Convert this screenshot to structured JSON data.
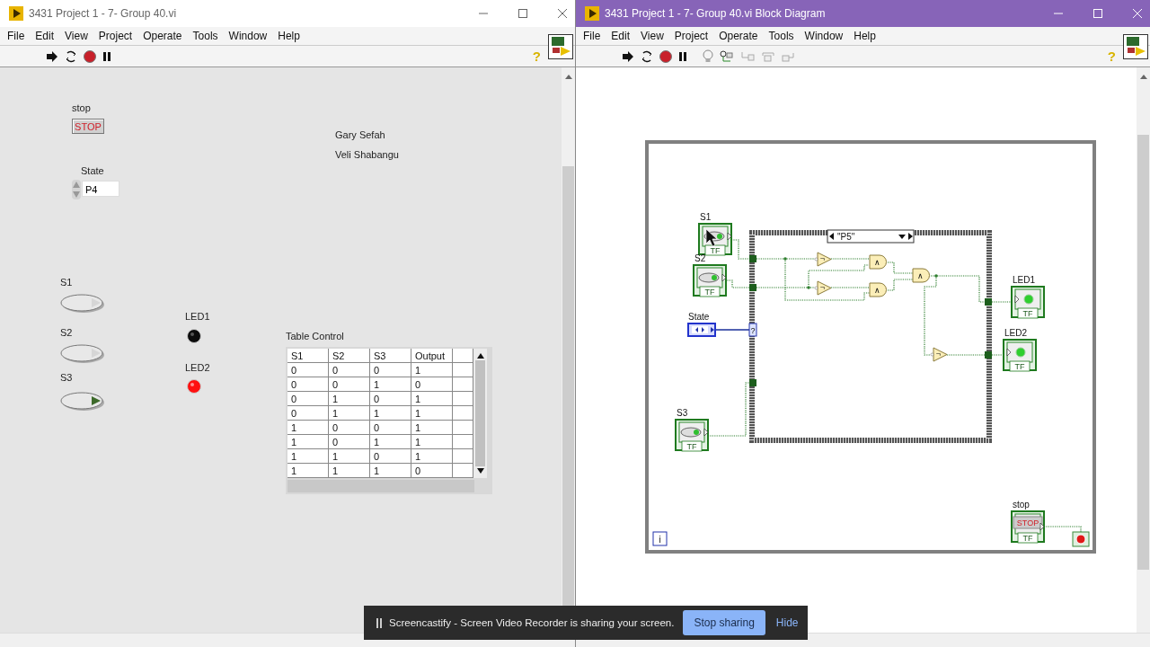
{
  "front_panel": {
    "title": "3431 Project 1 - 7- Group 40.vi",
    "menu": [
      "File",
      "Edit",
      "View",
      "Project",
      "Operate",
      "Tools",
      "Window",
      "Help"
    ],
    "help": "?",
    "stop": {
      "label": "stop",
      "text": "STOP"
    },
    "authors": [
      "Gary Sefah",
      "Veli Shabangu"
    ],
    "state": {
      "label": "State",
      "value": "P4"
    },
    "switches": [
      {
        "label": "S1",
        "on": false
      },
      {
        "label": "S2",
        "on": false
      },
      {
        "label": "S3",
        "on": true
      }
    ],
    "leds": [
      {
        "label": "LED1",
        "on": false
      },
      {
        "label": "LED2",
        "on": true
      }
    ],
    "table": {
      "label": "Table Control",
      "columns": [
        "S1",
        "S2",
        "S3",
        "Output"
      ],
      "rows": [
        [
          "0",
          "0",
          "0",
          "1"
        ],
        [
          "0",
          "0",
          "1",
          "0"
        ],
        [
          "0",
          "1",
          "0",
          "1"
        ],
        [
          "0",
          "1",
          "1",
          "1"
        ],
        [
          "1",
          "0",
          "0",
          "1"
        ],
        [
          "1",
          "0",
          "1",
          "1"
        ],
        [
          "1",
          "1",
          "0",
          "1"
        ],
        [
          "1",
          "1",
          "1",
          "0"
        ]
      ]
    }
  },
  "block_diagram": {
    "title": "3431 Project 1 - 7- Group 40.vi Block Diagram",
    "menu": [
      "File",
      "Edit",
      "View",
      "Project",
      "Operate",
      "Tools",
      "Window",
      "Help"
    ],
    "help": "?",
    "case_label": "\"P5\"",
    "selector_mark": "?",
    "iteration_mark": "i",
    "terminals": [
      {
        "kind": "bool_control",
        "label": "S1",
        "tf": "TF"
      },
      {
        "kind": "bool_control",
        "label": "S2",
        "tf": "TF"
      },
      {
        "kind": "enum",
        "label": "State"
      },
      {
        "kind": "bool_control",
        "label": "S3",
        "tf": "TF"
      },
      {
        "kind": "bool_indicator",
        "label": "LED1",
        "tf": "TF"
      },
      {
        "kind": "bool_indicator",
        "label": "LED2",
        "tf": "TF"
      },
      {
        "kind": "stop_control",
        "label": "stop",
        "text": "STOP",
        "tf": "TF"
      }
    ],
    "gates": [
      {
        "kind": "not",
        "symbol": "¬"
      },
      {
        "kind": "not",
        "symbol": "¬"
      },
      {
        "kind": "and",
        "symbol": "∧"
      },
      {
        "kind": "and",
        "symbol": "∧"
      },
      {
        "kind": "and",
        "symbol": "∧"
      },
      {
        "kind": "not",
        "symbol": "¬"
      }
    ]
  },
  "notification": {
    "text": "Screencastify - Screen Video Recorder is sharing your screen.",
    "button": "Stop sharing",
    "link": "Hide"
  }
}
